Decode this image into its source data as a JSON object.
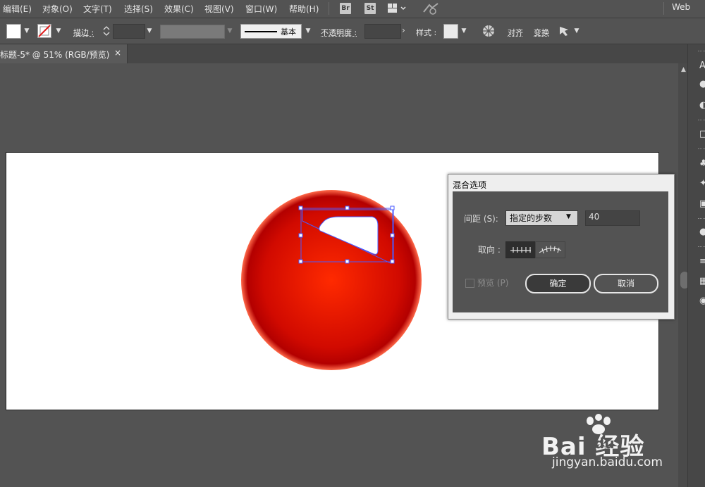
{
  "menu": {
    "items": [
      {
        "label": "编辑(E)"
      },
      {
        "label": "对象(O)"
      },
      {
        "label": "文字(T)"
      },
      {
        "label": "选择(S)"
      },
      {
        "label": "效果(C)"
      },
      {
        "label": "视图(V)"
      },
      {
        "label": "窗口(W)"
      },
      {
        "label": "帮助(H)"
      }
    ],
    "bridge_icon": "Br",
    "stock_icon": "St",
    "workspace": "Web"
  },
  "control": {
    "stroke_label": "描边 :",
    "brush_label": "基本",
    "opacity_label": "不透明度 :",
    "style_label": "样式 :",
    "align_label": "对齐",
    "transform_label": "变换"
  },
  "document": {
    "tab_label": "标题-5* @ 51% (RGB/预览)",
    "close_glyph": "×"
  },
  "dialog": {
    "title": "混合选项",
    "spacing_label": "间距 (S):",
    "spacing_value": "指定的步数",
    "steps_value": "40",
    "orientation_label": "取向 :",
    "preview_label": "预览 (P)",
    "ok_label": "确定",
    "cancel_label": "取消"
  },
  "watermark": {
    "brand": "Bai  经验",
    "brand_du": "du",
    "url": "jingyan.baidu.com"
  },
  "colors": {
    "ball_center": "#ff2a00",
    "ball_edge": "#b30000",
    "ball_rim": "#ff6a4a",
    "selection": "#4a5aff",
    "ui_bg": "#535353"
  }
}
